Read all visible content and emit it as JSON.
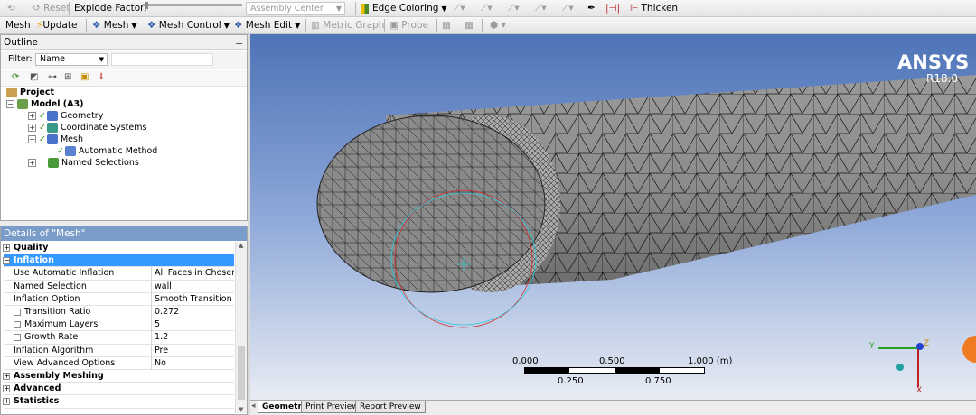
{
  "toolbar1": {
    "reset_label": "Reset",
    "explode_label": "Explode Factor:",
    "assembly_center": "Assembly Center",
    "edge_coloring_label": "Edge Coloring",
    "thicken_label": "Thicken"
  },
  "toolbar2": {
    "mesh_label": "Mesh",
    "update_label": "Update",
    "mesh_menu_label": "Mesh",
    "mesh_control_label": "Mesh Control",
    "mesh_edit_label": "Mesh Edit",
    "metric_graph_label": "Metric Graph",
    "probe_label": "Probe"
  },
  "outline": {
    "title": "Outline",
    "filter_label": "Filter:",
    "filter_value": "Name",
    "tree": {
      "project": "Project",
      "model": "Model (A3)",
      "geometry": "Geometry",
      "coordinate_systems": "Coordinate Systems",
      "mesh": "Mesh",
      "automatic_method": "Automatic Method",
      "named_selections": "Named Selections"
    }
  },
  "details": {
    "title": "Details of \"Mesh\"",
    "groups": {
      "quality": "Quality",
      "inflation": "Inflation",
      "assembly_meshing": "Assembly Meshing",
      "advanced": "Advanced",
      "statistics": "Statistics"
    },
    "rows": [
      {
        "key": "Use Automatic Inflation",
        "value": "All Faces in Chosen ..."
      },
      {
        "key": "Named Selection",
        "value": "wall"
      },
      {
        "key": "Inflation Option",
        "value": "Smooth Transition"
      },
      {
        "key": "Transition Ratio",
        "value": "0.272"
      },
      {
        "key": "Maximum Layers",
        "value": "5"
      },
      {
        "key": "Growth Rate",
        "value": "1.2"
      },
      {
        "key": "Inflation Algorithm",
        "value": "Pre"
      },
      {
        "key": "View Advanced Options",
        "value": "No"
      }
    ]
  },
  "viewport": {
    "brand": "ANSYS",
    "version": "R18.0",
    "scale_top": [
      "0.000",
      "0.500",
      "1.000 (m)"
    ],
    "scale_bottom": [
      "0.250",
      "0.750"
    ],
    "triad_y": "Y",
    "triad_z": "Z",
    "triad_x": "X"
  },
  "tabs": [
    "Geometry",
    "Print Preview",
    "Report Preview"
  ],
  "colors": {
    "selection": "#3399ff",
    "viewport_top": "#4d73b7",
    "viewport_bottom": "#e8ecf4"
  }
}
